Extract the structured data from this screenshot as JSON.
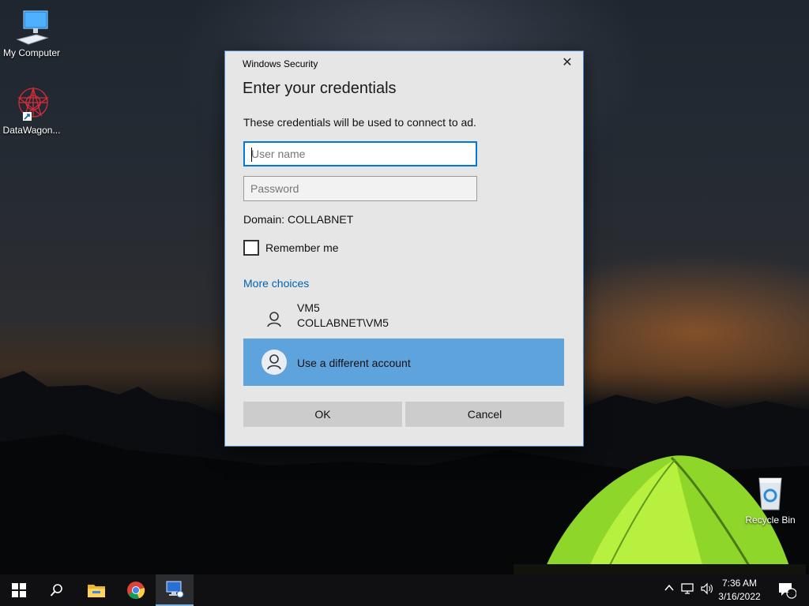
{
  "desktop": {
    "icons": [
      {
        "label": "My Computer",
        "icon": "my-computer-icon"
      },
      {
        "label": "DataWagon...",
        "icon": "datawagon-icon"
      },
      {
        "label": "Recycle Bin",
        "icon": "recycle-bin-icon"
      }
    ]
  },
  "dialog": {
    "caption": "Windows Security",
    "close_glyph": "✕",
    "title": "Enter your credentials",
    "description": "These credentials will be used to connect to ad.",
    "username_placeholder": "User name",
    "password_placeholder": "Password",
    "domain": "Domain: COLLABNET",
    "remember_label": "Remember me",
    "remember_checked": false,
    "more_choices": "More choices",
    "accounts": [
      {
        "name": "VM5",
        "detail": "COLLABNET\\VM5"
      },
      {
        "name": "Use a different account"
      }
    ],
    "ok_label": "OK",
    "cancel_label": "Cancel",
    "accent": "#0078d7",
    "selected_bg": "#5fa3dd"
  },
  "taskbar": {
    "apps": [
      "start-icon",
      "search-icon",
      "file-explorer-icon",
      "chrome-icon",
      "remote-desktop-icon"
    ],
    "tray": [
      "chevron-up-icon",
      "network-icon",
      "volume-icon"
    ],
    "time": "7:36 AM",
    "date": "3/16/2022",
    "notification_count": "1"
  }
}
